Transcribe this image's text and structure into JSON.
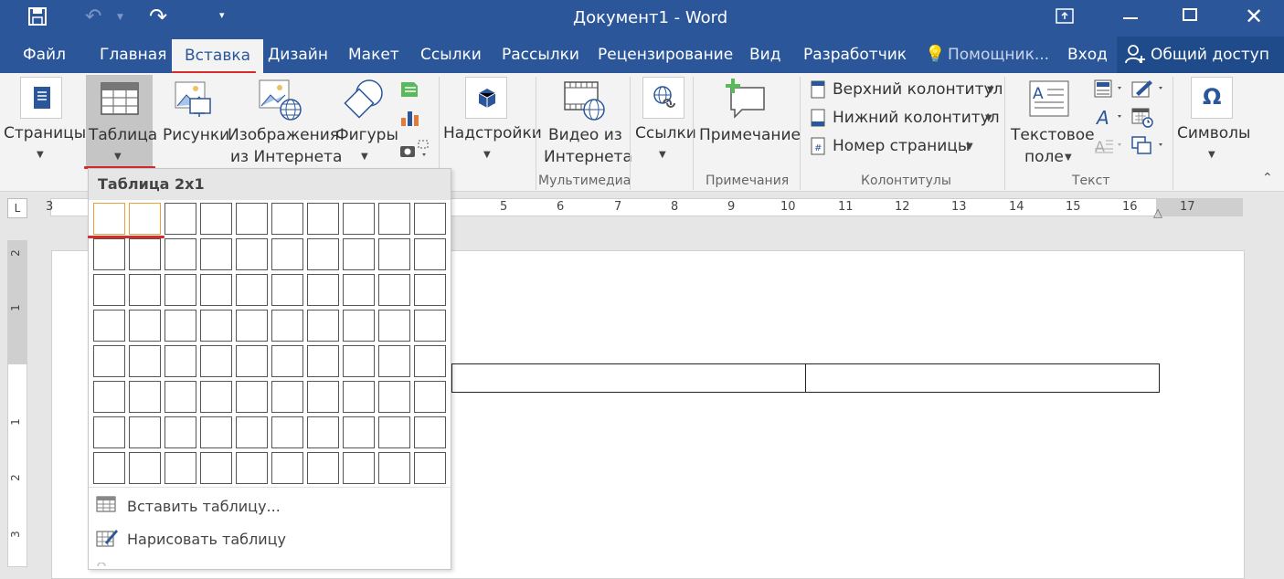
{
  "title": "Документ1 - Word",
  "tabs": [
    "Файл",
    "Главная",
    "Вставка",
    "Дизайн",
    "Макет",
    "Ссылки",
    "Рассылки",
    "Рецензирование",
    "Вид",
    "Разработчик"
  ],
  "active_tab": "Вставка",
  "assistant": "Помощник...",
  "signin": "Вход",
  "share": "Общий доступ",
  "ribbon": {
    "pages": "Страницы",
    "table": "Таблица",
    "pictures": "Рисунки",
    "online_images_1": "Изображения",
    "online_images_2": "из Интернета",
    "shapes": "Фигуры",
    "addins": "Надстройки",
    "video_1": "Видео из",
    "video_2": "Интернета",
    "links": "Ссылки",
    "comment": "Примечание",
    "header": "Верхний колонтитул",
    "footer": "Нижний колонтитул",
    "page_number": "Номер страницы",
    "textbox_1": "Текстовое",
    "textbox_2": "поле",
    "symbols": "Символы",
    "omega": "Ω"
  },
  "groups": {
    "multimedia": "Мультимедиа",
    "comments": "Примечания",
    "headers_footers": "Колонтитулы",
    "text": "Текст"
  },
  "ruler_numbers": [
    "3",
    "5",
    "6",
    "7",
    "8",
    "9",
    "10",
    "11",
    "12",
    "13",
    "14",
    "15",
    "16",
    "17"
  ],
  "vruler_numbers": [
    "2",
    "1",
    "1",
    "2",
    "3"
  ],
  "dropdown": {
    "header": "Таблица 2x1",
    "insert_table": "Вставить таблицу...",
    "draw_table": "Нарисовать таблицу",
    "grid_cols": 10,
    "grid_rows": 8,
    "selected_cols": 2,
    "selected_rows": 1
  }
}
